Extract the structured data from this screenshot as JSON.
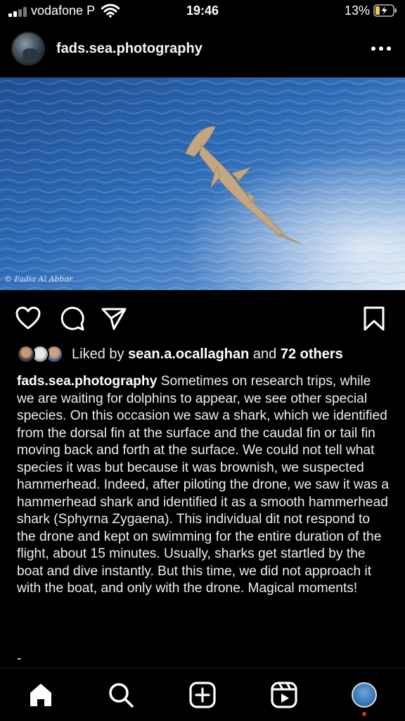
{
  "status_bar": {
    "carrier": "vodafone P",
    "time": "19:46",
    "battery": "13%"
  },
  "post": {
    "username": "fads.sea.photography",
    "watermark": "© Fadia Al Abbar",
    "likes": {
      "prefix": "Liked by ",
      "user": "sean.a.ocallaghan",
      "middle": " and ",
      "others": "72 others"
    },
    "caption": {
      "author": "fads.sea.photography",
      "text": "Sometimes on research trips, while we are waiting for dolphins to appear, we see other special species. On this occasion we saw a shark, which we identified from the dorsal fin at the surface and the caudal fin or tail fin moving back and forth at the surface. We could not tell what species it was but because it was brownish, we suspected hammerhead. Indeed, after piloting the drone, we saw it was a hammerhead shark and identified it as a smooth hammerhead shark (Sphyrna Zygaena). This individual dit not respond to the drone and kept on swimming for the entire duration of the flight, about 15 minutes. Usually, sharks get startled by the boat and dive instantly. But this time, we did not approach it with the boat, and only with the drone. Magical moments!",
      "trailing": "-"
    }
  },
  "icons": {
    "status": [
      "signal-icon",
      "wifi-icon",
      "battery-charging-icon"
    ],
    "header": [
      "more-icon"
    ],
    "actions": [
      "heart-icon",
      "comment-icon",
      "share-icon",
      "bookmark-icon"
    ],
    "nav": [
      "home-icon",
      "search-icon",
      "create-icon",
      "reels-icon",
      "profile-avatar"
    ]
  },
  "colors": {
    "background": "#000000",
    "battery_charging": "#f2c94c",
    "notification_dot": "#e0243d",
    "sea": "#2f6db8"
  }
}
